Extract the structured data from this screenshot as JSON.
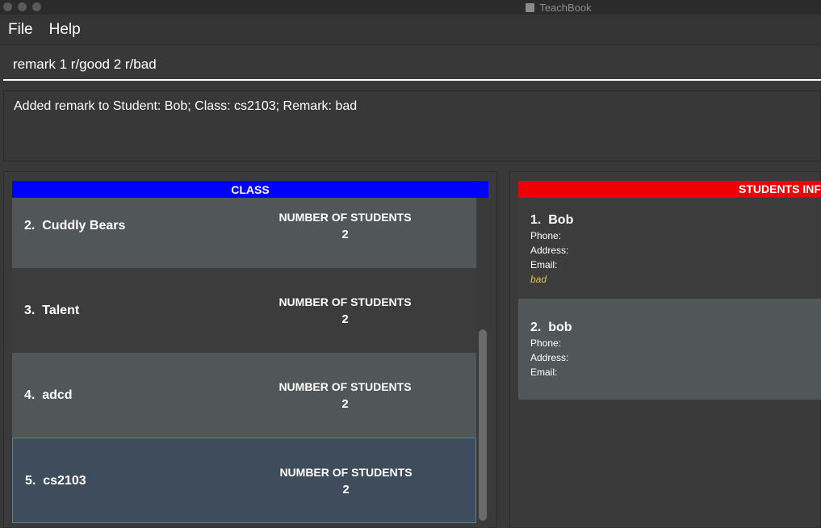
{
  "window": {
    "title": "TeachBook"
  },
  "menu": {
    "file": "File",
    "help": "Help"
  },
  "command": {
    "value": "remark 1 r/good 2 r/bad"
  },
  "result": {
    "text": "Added remark to Student: Bob; Class: cs2103; Remark: bad"
  },
  "class_panel": {
    "header": "CLASS",
    "items": [
      {
        "index": "2.",
        "name": "Cuddly Bears",
        "count_label": "NUMBER OF STUDENTS",
        "count": "2"
      },
      {
        "index": "3.",
        "name": "Talent",
        "count_label": "NUMBER OF STUDENTS",
        "count": "2"
      },
      {
        "index": "4.",
        "name": "adcd",
        "count_label": "NUMBER OF STUDENTS",
        "count": "2"
      },
      {
        "index": "5.",
        "name": "cs2103",
        "count_label": "NUMBER OF STUDENTS",
        "count": "2"
      }
    ]
  },
  "students_panel": {
    "header": "STUDENTS INF",
    "items": [
      {
        "index": "1.",
        "name": "Bob",
        "phone": "Phone:",
        "address": "Address:",
        "email": "Email:",
        "remark": "bad"
      },
      {
        "index": "2.",
        "name": "bob",
        "phone": "Phone:",
        "address": "Address:",
        "email": "Email:"
      }
    ]
  },
  "colors": {
    "class_header": "#0000ff",
    "students_header": "#ee0000",
    "remark": "#e0c04a",
    "selected": "#3f4c5c"
  }
}
